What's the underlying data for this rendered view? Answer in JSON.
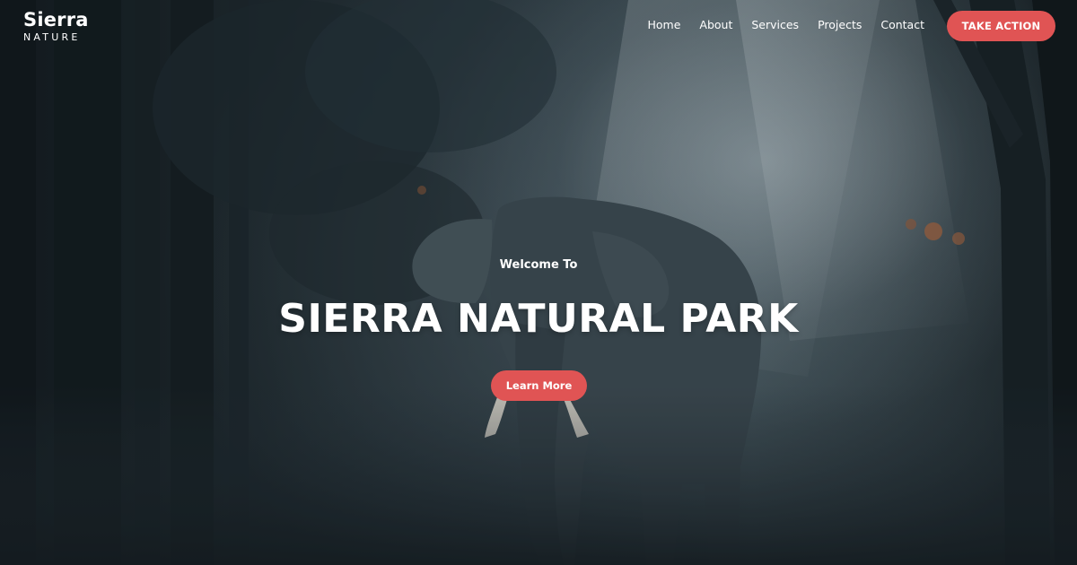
{
  "header": {
    "logo": {
      "title": "Sierra",
      "subtitle": "NATURE"
    },
    "nav": [
      {
        "label": "Home"
      },
      {
        "label": "About"
      },
      {
        "label": "Services"
      },
      {
        "label": "Projects"
      },
      {
        "label": "Contact"
      }
    ],
    "cta_label": "TAKE ACTION"
  },
  "hero": {
    "welcome": "Welcome To",
    "headline": "SIERRA NATURAL PARK",
    "button_label": "Learn More"
  },
  "colors": {
    "accent": "#e05454",
    "text": "#ffffff"
  }
}
